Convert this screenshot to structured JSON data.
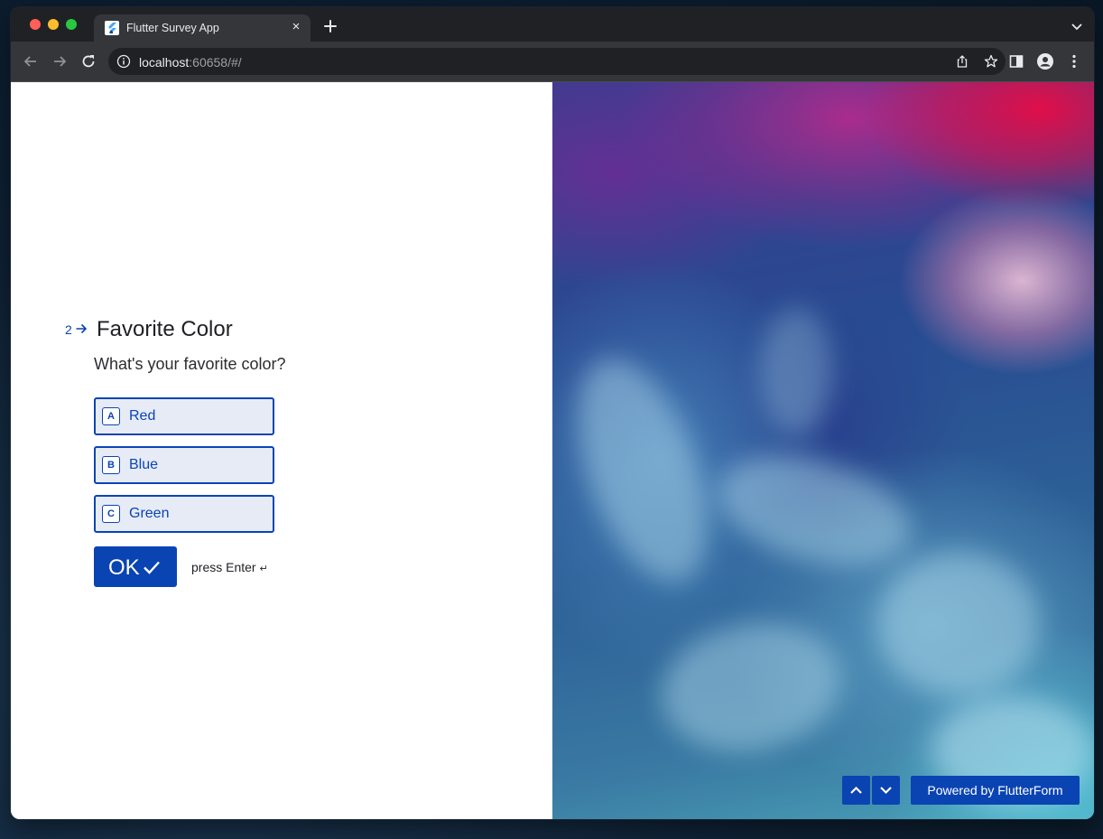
{
  "browser": {
    "tab": {
      "title": "Flutter Survey App",
      "favicon": "flutter-logo-icon",
      "close_glyph": "×"
    },
    "new_tab_icon": "plus-icon",
    "address": {
      "host": "localhost",
      "rest": ":60658/#/"
    },
    "icons": [
      "back-arrow-icon",
      "forward-arrow-icon",
      "reload-icon",
      "info-icon",
      "share-icon",
      "star-icon",
      "side-panel-icon",
      "profile-icon",
      "kebab-menu-icon",
      "tab-search-chevron-icon"
    ]
  },
  "survey": {
    "question_number": "2",
    "title": "Favorite Color",
    "description": "What's your favorite color?",
    "options": [
      {
        "key": "A",
        "label": "Red"
      },
      {
        "key": "B",
        "label": "Blue"
      },
      {
        "key": "C",
        "label": "Green"
      }
    ],
    "ok_label": "OK",
    "hint": "press Enter",
    "hint_glyph": "↵"
  },
  "footer": {
    "powered_by": "Powered by FlutterForm"
  },
  "colors": {
    "accent": "#0a44b3",
    "option_bg": "#e6ebf6",
    "chrome_dark": "#202124",
    "chrome_toolbar": "#35363a"
  }
}
